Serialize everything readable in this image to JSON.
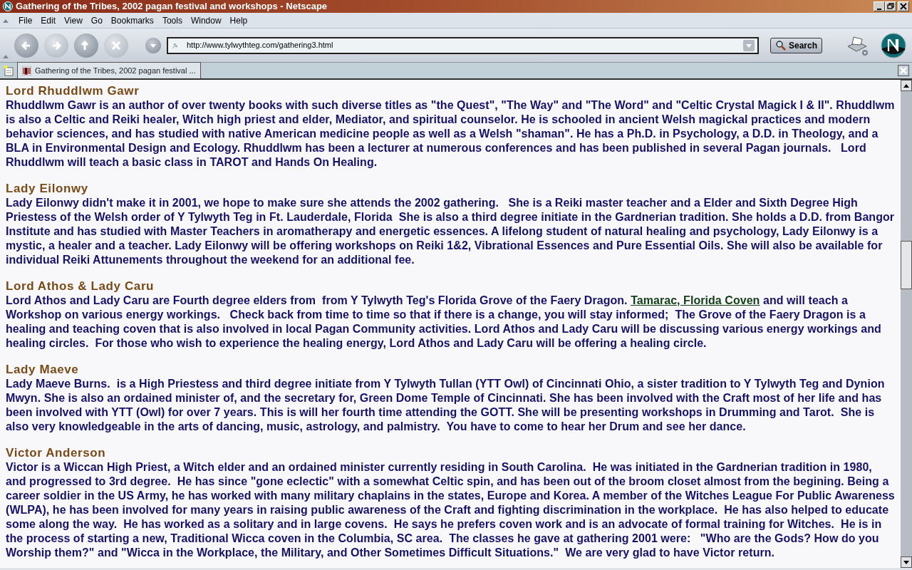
{
  "window": {
    "title": "Gathering of the Tribes, 2002 pagan festival and workshops - Netscape"
  },
  "menu": [
    "File",
    "Edit",
    "View",
    "Go",
    "Bookmarks",
    "Tools",
    "Window",
    "Help"
  ],
  "nav_buttons": [
    {
      "kind": "back",
      "disabled": false
    },
    {
      "kind": "forward",
      "disabled": true
    },
    {
      "kind": "reload",
      "disabled": false
    },
    {
      "kind": "stop",
      "disabled": true
    }
  ],
  "address": {
    "value": "http://www.tylwythteg.com/gathering3.html"
  },
  "search_button": "Search",
  "tabs": [
    {
      "label": "Gathering of the Tribes, 2002 pagan festival ...",
      "selected": true
    }
  ],
  "sections": [
    {
      "heading": "Lord Rhuddlwm Gawr",
      "body": [
        {
          "kind": "text",
          "text": "Rhuddlwm Gawr is an author of over twenty books with such diverse titles as \"the Quest\", \"The Way\" and \"The Word\" and \"Celtic Crystal Magick I & II\". Rhuddlwm is also a Celtic and Reiki healer, Witch high priest and elder, Mediator, and spiritual counselor. He is schooled in ancient Welsh magickal practices and modern behavior sciences, and has studied with native American medicine people as well as a Welsh \"shaman\". He has a Ph.D. in Psychology, a D.D. in Theology, and a BLA in Environmental Design and Ecology. Rhuddlwm has been a lecturer at numerous conferences and has been published in several Pagan journals.   Lord Rhuddlwm will teach a basic class in TAROT and Hands On Healing."
        }
      ]
    },
    {
      "heading": "Lady Eilonwy",
      "body": [
        {
          "kind": "text",
          "text": "Lady Eilonwy didn't make it in 2001, we hope to make sure she attends the 2002 gathering.   She is a Reiki master teacher and a Elder and Sixth Degree High Priestess of the Welsh order of Y Tylwyth Teg in Ft. Lauderdale, Florida  She is also a third degree initiate in the Gardnerian tradition. She holds a D.D. from Bangor Institute and has studied with Master Teachers in aromatherapy and energetic essences. A lifelong student of natural healing and psychology, Lady Eilonwy is a mystic, a healer and a teacher. Lady Eilonwy will be offering workshops on Reiki 1&2, Vibrational Essences and Pure Essential Oils. She will also be available for individual Reiki Attunements throughout the weekend for an additional fee."
        }
      ]
    },
    {
      "heading": "Lord Athos & Lady Caru",
      "body": [
        {
          "kind": "text",
          "text": "Lord Athos and Lady Caru are Fourth degree elders from  from Y Tylwyth Teg's Florida Grove of the Faery Dragon. "
        },
        {
          "kind": "link",
          "text": "Tamarac, Florida Coven"
        },
        {
          "kind": "text",
          "text": " and will teach a Workshop on various energy workings.   Check back from time to time so that if there is a change, you will stay informed;  The Grove of the Faery Dragon is a healing and teaching coven that is also involved in local Pagan Community activities. Lord Athos and Lady Caru will be discussing various energy workings and healing circles.  For those who wish to experience the healing energy, Lord Athos and Lady Caru will be offering a healing circle."
        }
      ]
    },
    {
      "heading": "Lady Maeve",
      "body": [
        {
          "kind": "text",
          "text": "Lady Maeve Burns.  is a High Priestess and third degree initiate from Y Tylwyth Tullan (YTT Owl) of Cincinnati Ohio, a sister tradition to Y Tylwyth Teg and Dynion Mwyn. She is also an ordained minister of, and the secretary for, Green Dome Temple of Cincinnati. She has been involved with the Craft most of her life and has been involved with YTT (Owl) for over 7 years. This is will her fourth time attending the GOTT. She will be presenting workshops in Drumming and Tarot.  She is also very knowledgeable in the arts of dancing, music, astrology, and palmistry.  You have to come to hear her Drum and see her dance."
        }
      ]
    },
    {
      "heading": "Victor Anderson",
      "body": [
        {
          "kind": "text",
          "text": "Victor is a Wiccan High Priest, a Witch elder and an ordained minister currently residing in South Carolina.  He was initiated in the Gardnerian tradition in 1980, and progressed to 3rd degree.  He has since \"gone eclectic\" with a somewhat Celtic spin, and has been out of the broom closet almost from the begining. Being a career soldier in the US Army, he has worked with many military chaplains in the states, Europe and Korea. A member of the Witches League For Public Awareness (WLPA), he has been involved for many years in raising public awareness of the Craft and fighting discrimination in the workplace.  He has also helped to educate some along the way.  He has worked as a solitary and in large covens.  He says he prefers coven work and is an advocate of formal training for Witches.  He is in the process of starting a new, Traditional Wicca coven in the Columbia, SC area.  The classes he gave at gathering 2001 were:   \"Who are the Gods? How do you Worship them?\" and \"Wicca in the Workplace, the Military, and Other Sometimes Difficult Situations.\"  We are very glad to have Victor return."
        }
      ]
    }
  ]
}
